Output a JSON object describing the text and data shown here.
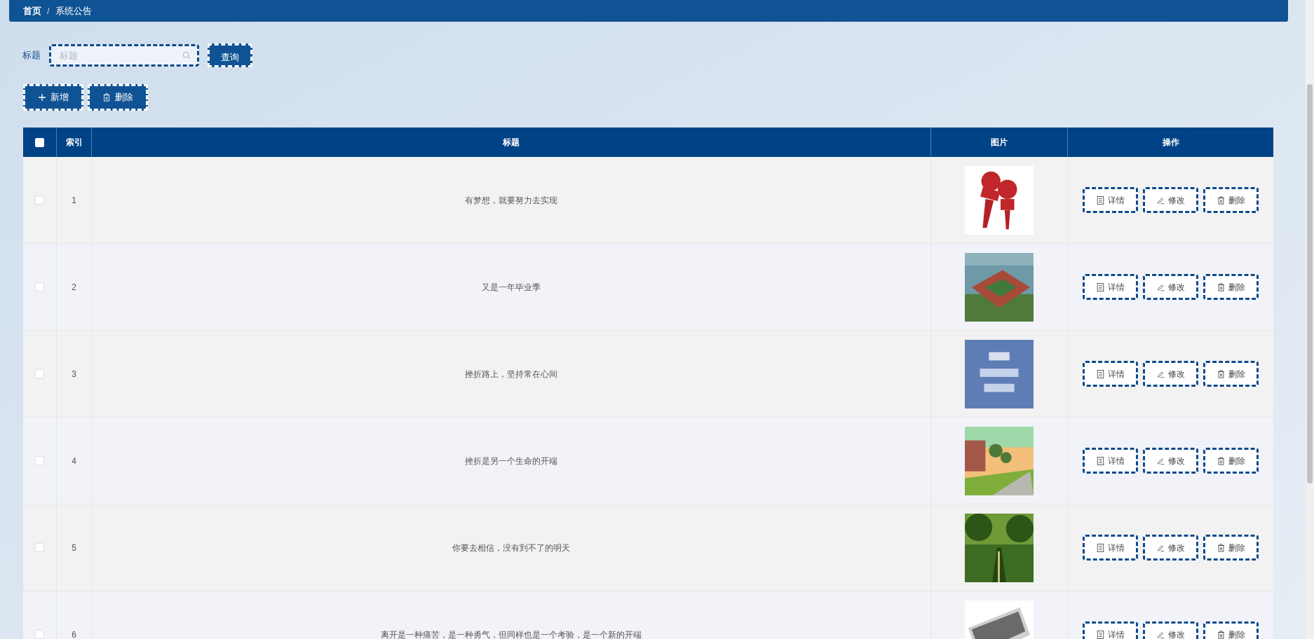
{
  "breadcrumb": [
    "首页",
    "系统公告"
  ],
  "breadcrumb_separator": "/",
  "search": {
    "label": "标题",
    "placeholder": "标题",
    "button": "查询"
  },
  "toolbar": [
    {
      "kind": "add",
      "label": "新增"
    },
    {
      "kind": "delete",
      "label": "删除"
    }
  ],
  "table": {
    "select_all": {
      "checked": false
    },
    "columns": [
      "索引",
      "标题",
      "图片",
      "操作"
    ],
    "rows": [
      {
        "checked": false,
        "index": "1",
        "title": "有梦想，就要努力去实现",
        "picture": {
          "kind": "picture"
        },
        "actions": [
          {
            "kind": "detail",
            "label": "详情"
          },
          {
            "kind": "edit",
            "label": "修改"
          },
          {
            "kind": "delete",
            "label": "删除"
          }
        ]
      },
      {
        "checked": false,
        "index": "2",
        "title": "又是一年毕业季",
        "picture": {
          "kind": "picture"
        },
        "actions": [
          {
            "kind": "detail",
            "label": "详情"
          },
          {
            "kind": "edit",
            "label": "修改"
          },
          {
            "kind": "delete",
            "label": "删除"
          }
        ]
      },
      {
        "checked": false,
        "index": "3",
        "title": "挫折路上，坚持常在心间",
        "picture": {
          "kind": "picture"
        },
        "actions": [
          {
            "kind": "detail",
            "label": "详情"
          },
          {
            "kind": "edit",
            "label": "修改"
          },
          {
            "kind": "delete",
            "label": "删除"
          }
        ]
      },
      {
        "checked": false,
        "index": "4",
        "title": "挫折是另一个生命的开端",
        "picture": {
          "kind": "picture"
        },
        "actions": [
          {
            "kind": "detail",
            "label": "详情"
          },
          {
            "kind": "edit",
            "label": "修改"
          },
          {
            "kind": "delete",
            "label": "删除"
          }
        ]
      },
      {
        "checked": false,
        "index": "5",
        "title": "你要去相信，没有到不了的明天",
        "picture": {
          "kind": "picture"
        },
        "actions": [
          {
            "kind": "detail",
            "label": "详情"
          },
          {
            "kind": "edit",
            "label": "修改"
          },
          {
            "kind": "delete",
            "label": "删除"
          }
        ]
      },
      {
        "checked": false,
        "index": "6",
        "title": "离开是一种痛苦，是一种勇气，但同样也是一个考验，是一个新的开端",
        "picture": {
          "kind": "picture"
        },
        "actions": [
          {
            "kind": "detail",
            "label": "详情"
          },
          {
            "kind": "edit",
            "label": "修改"
          },
          {
            "kind": "delete",
            "label": "删除"
          }
        ]
      }
    ]
  }
}
